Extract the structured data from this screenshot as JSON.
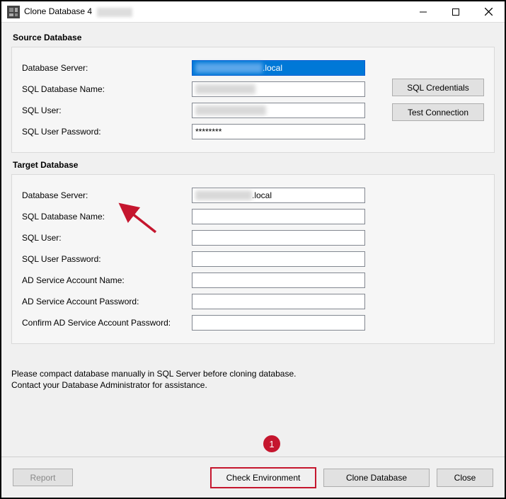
{
  "window": {
    "title": "Clone Database 4"
  },
  "source": {
    "groupTitle": "Source Database",
    "labels": {
      "dbServer": "Database Server:",
      "dbName": "SQL Database Name:",
      "sqlUser": "SQL User:",
      "sqlPass": "SQL User Password:"
    },
    "values": {
      "dbServerSuffix": ".local",
      "sqlPass": "********"
    },
    "buttons": {
      "sqlCred": "SQL Credentials",
      "testConn": "Test Connection"
    }
  },
  "target": {
    "groupTitle": "Target Database",
    "labels": {
      "dbServer": "Database Server:",
      "dbName": "SQL Database Name:",
      "sqlUser": "SQL User:",
      "sqlPass": "SQL User Password:",
      "adName": "AD Service Account Name:",
      "adPass": "AD Service Account Password:",
      "adPassConfirm": "Confirm AD Service Account Password:"
    },
    "values": {
      "dbServerSuffix": ".local"
    }
  },
  "note": {
    "line1": "Please compact database manually in SQL Server before cloning database.",
    "line2": "Contact your Database Administrator for assistance."
  },
  "footer": {
    "report": "Report",
    "checkEnv": "Check Environment",
    "cloneDb": "Clone Database",
    "close": "Close"
  },
  "badge": "1"
}
